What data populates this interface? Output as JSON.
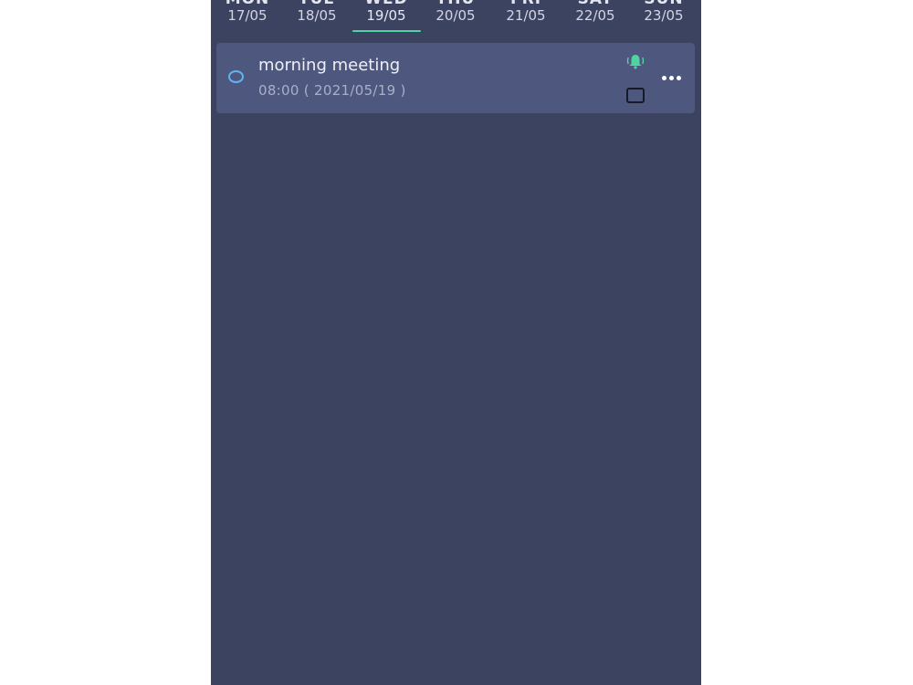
{
  "week": {
    "days": [
      {
        "name": "MON",
        "date": "17/05"
      },
      {
        "name": "TUE",
        "date": "18/05"
      },
      {
        "name": "WED",
        "date": "19/05"
      },
      {
        "name": "THU",
        "date": "20/05"
      },
      {
        "name": "FRI",
        "date": "21/05"
      },
      {
        "name": "SAT",
        "date": "22/05"
      },
      {
        "name": "SUN",
        "date": "23/05"
      }
    ],
    "selected_date": "19/05"
  },
  "tasks": [
    {
      "title": "morning meeting",
      "time": "08:00 ( 2021/05/19 )",
      "reminder_icon": "bell-ringing-icon",
      "checked": false
    }
  ],
  "colors": {
    "background": "#3b4360",
    "card": "#4e587f",
    "accent": "#4fd3a0",
    "checkbox_ring": "#5fb4f0"
  }
}
